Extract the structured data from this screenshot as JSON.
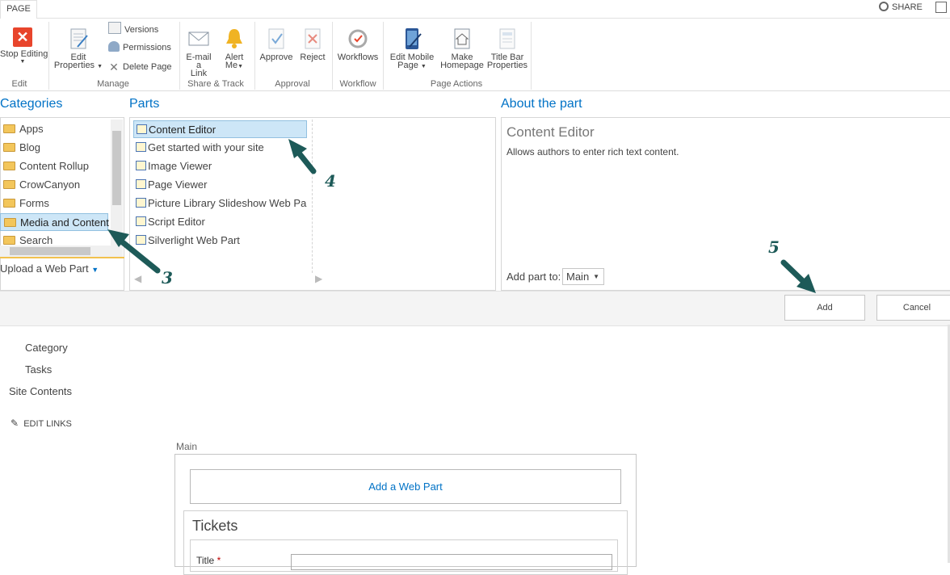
{
  "topbar": {
    "tab": "PAGE",
    "share": "SHARE"
  },
  "ribbon": {
    "edit": {
      "stop_editing": "Stop Editing",
      "group": "Edit"
    },
    "manage": {
      "edit_properties_1": "Edit",
      "edit_properties_2": "Properties",
      "versions": "Versions",
      "permissions": "Permissions",
      "delete_page": "Delete Page",
      "group": "Manage"
    },
    "share_track": {
      "email_1": "E-mail a",
      "email_2": "Link",
      "alert_1": "Alert",
      "alert_2": "Me",
      "group": "Share & Track"
    },
    "approval": {
      "approve": "Approve",
      "reject": "Reject",
      "group": "Approval"
    },
    "workflow": {
      "workflows": "Workflows",
      "group": "Workflow"
    },
    "page_actions": {
      "mobile_1": "Edit Mobile",
      "mobile_2": "Page",
      "home_1": "Make",
      "home_2": "Homepage",
      "titlebar_1": "Title Bar",
      "titlebar_2": "Properties",
      "group": "Page Actions"
    }
  },
  "categories": {
    "title": "Categories",
    "items": [
      "Apps",
      "Blog",
      "Content Rollup",
      "CrowCanyon",
      "Forms",
      "Media and Content",
      "Search"
    ],
    "upload": "Upload a Web Part"
  },
  "parts": {
    "title": "Parts",
    "items": [
      "Content Editor",
      "Get started with your site",
      "Image Viewer",
      "Page Viewer",
      "Picture Library Slideshow Web Par",
      "Script Editor",
      "Silverlight Web Part"
    ]
  },
  "about": {
    "title": "About the part",
    "part_name": "Content Editor",
    "description": "Allows authors to enter rich text content.",
    "add_part_to_label": "Add part to:",
    "add_part_to_value": "Main"
  },
  "buttons": {
    "add": "Add",
    "cancel": "Cancel"
  },
  "left_nav": {
    "category": "Category",
    "tasks": "Tasks",
    "site_contents": "Site Contents",
    "edit_links": "EDIT LINKS"
  },
  "main": {
    "zone_label": "Main",
    "add_web_part": "Add a Web Part",
    "tickets_title": "Tickets",
    "title_field_label": "Title",
    "required_mark": "*"
  },
  "annotations": {
    "step3": "3",
    "step4": "4",
    "step5": "5"
  },
  "colors": {
    "accent": "#0072c6",
    "arrow": "#1d5a58",
    "stop_red": "#e8452c",
    "alert_gold": "#f0b323"
  }
}
